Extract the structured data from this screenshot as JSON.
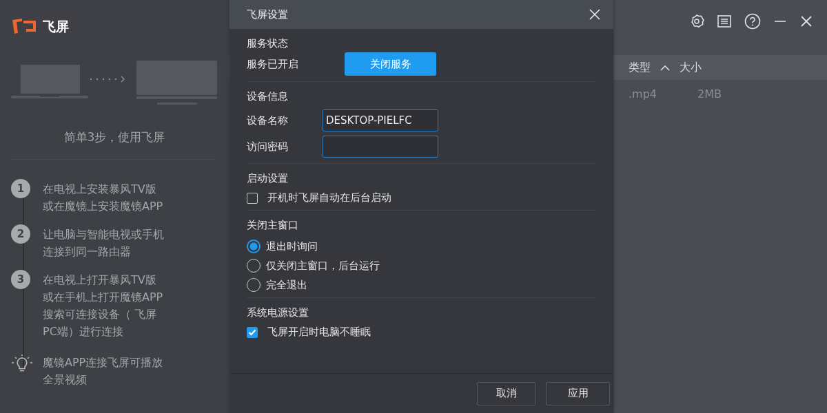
{
  "sidebar": {
    "logo_text": "飞屏",
    "tagline": "简单3步，使用飞屏",
    "steps": [
      {
        "number": "1",
        "lines": [
          "在电视上安装暴风TV版",
          "或在魔镜上安装魔镜APP"
        ]
      },
      {
        "number": "2",
        "lines": [
          "让电脑与智能电视或手机",
          "连接到同一路由器"
        ]
      },
      {
        "number": "3",
        "lines": [
          "在电视上打开暴风TV版",
          "或在手机上打开魔镜APP",
          "搜索可连接设备（ 飞屏",
          "PC端）进行连接"
        ]
      }
    ],
    "tip": {
      "lines": [
        "魔镜APP连接飞屏可播放",
        "全景视频"
      ]
    }
  },
  "table": {
    "columns": [
      {
        "label": "类型",
        "sorted": true
      },
      {
        "label": "大小",
        "sorted": false
      }
    ],
    "rows": [
      [
        ".mp4",
        "2MB"
      ]
    ]
  },
  "dialog": {
    "title": "飞屏设置",
    "sections": [
      {
        "kind": "service",
        "heading": "服务状态",
        "status": "服务已开启",
        "button": "关闭服务"
      },
      {
        "kind": "fields",
        "heading": "设备信息",
        "fields": [
          {
            "label": "设备名称",
            "value": "DESKTOP-PIELFC"
          },
          {
            "label": "访问密码"
          }
        ]
      },
      {
        "kind": "checks",
        "heading": "启动设置",
        "options": [
          {
            "label": "开机时飞屏自动在后台启动",
            "checked": false
          }
        ]
      },
      {
        "kind": "radios",
        "heading": "关闭主窗口",
        "options": [
          {
            "label": "退出时询问",
            "selected": true
          },
          {
            "label": "仅关闭主窗口，后台运行",
            "selected": false
          },
          {
            "label": "完全退出",
            "selected": false
          }
        ]
      },
      {
        "kind": "checks",
        "heading": "系统电源设置",
        "options": [
          {
            "label": "飞屏开启时电脑不睡眠",
            "checked": true
          }
        ]
      }
    ],
    "buttons": [
      "取消",
      "应用"
    ]
  }
}
